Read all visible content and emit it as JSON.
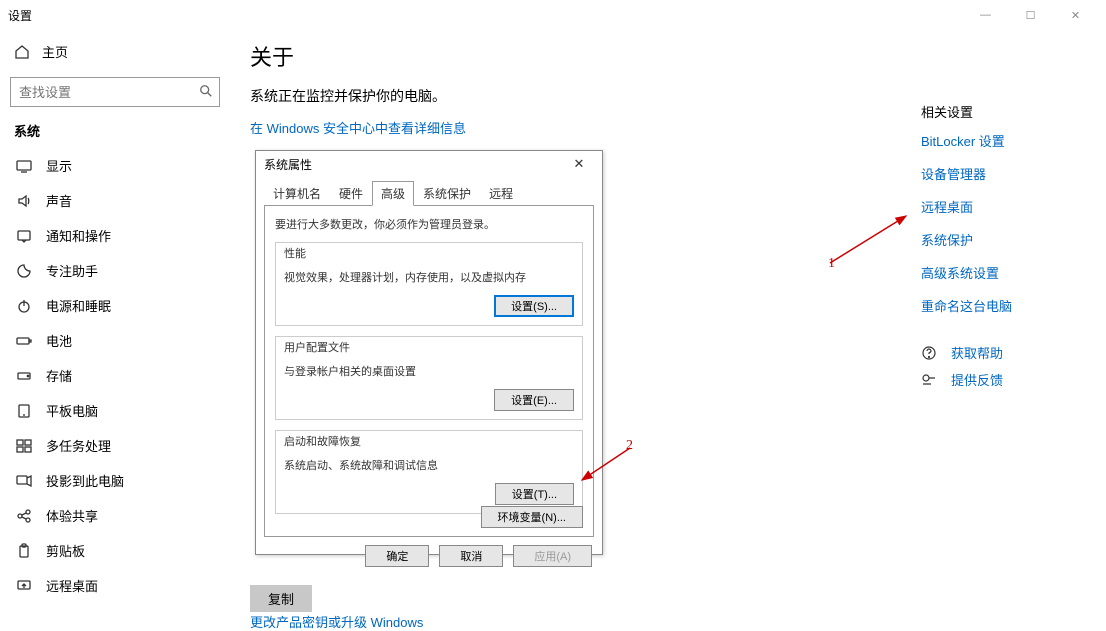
{
  "window": {
    "title": "设置",
    "minimize": "—",
    "maximize": "☐",
    "close": "✕"
  },
  "sidebar": {
    "home": "主页",
    "search_placeholder": "查找设置",
    "section": "系统",
    "items": [
      {
        "label": "显示"
      },
      {
        "label": "声音"
      },
      {
        "label": "通知和操作"
      },
      {
        "label": "专注助手"
      },
      {
        "label": "电源和睡眠"
      },
      {
        "label": "电池"
      },
      {
        "label": "存储"
      },
      {
        "label": "平板电脑"
      },
      {
        "label": "多任务处理"
      },
      {
        "label": "投影到此电脑"
      },
      {
        "label": "体验共享"
      },
      {
        "label": "剪贴板"
      },
      {
        "label": "远程桌面"
      }
    ]
  },
  "page": {
    "heading": "关于",
    "monitor_text": "系统正在监控并保护你的电脑。",
    "security_link": "在 Windows 安全中心中查看详细信息",
    "copy_btn": "复制",
    "bottom_link": "更改产品密钥或升级 Windows"
  },
  "right": {
    "title": "相关设置",
    "links": [
      "BitLocker 设置",
      "设备管理器",
      "远程桌面",
      "系统保护",
      "高级系统设置",
      "重命名这台电脑"
    ],
    "help": "获取帮助",
    "feedback": "提供反馈"
  },
  "dialog": {
    "title": "系统属性",
    "tabs": [
      "计算机名",
      "硬件",
      "高级",
      "系统保护",
      "远程"
    ],
    "active_tab": 2,
    "admin_note": "要进行大多数更改，你必须作为管理员登录。",
    "perf": {
      "title": "性能",
      "desc": "视觉效果，处理器计划，内存使用，以及虚拟内存",
      "btn": "设置(S)..."
    },
    "profiles": {
      "title": "用户配置文件",
      "desc": "与登录帐户相关的桌面设置",
      "btn": "设置(E)..."
    },
    "startup": {
      "title": "启动和故障恢复",
      "desc": "系统启动、系统故障和调试信息",
      "btn": "设置(T)..."
    },
    "env_btn": "环境变量(N)...",
    "ok": "确定",
    "cancel": "取消",
    "apply": "应用(A)"
  },
  "annotations": {
    "one": "1",
    "two": "2"
  }
}
